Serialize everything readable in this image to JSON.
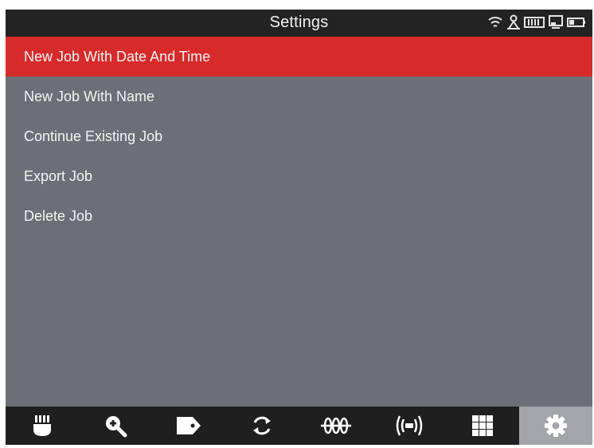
{
  "header": {
    "title": "Settings",
    "status_icons": [
      "wifi-icon",
      "bluetooth-icon",
      "keyboard-icon",
      "monitor-icon",
      "battery-icon"
    ]
  },
  "menu": {
    "items": [
      {
        "label": "New Job With Date And Time",
        "selected": true
      },
      {
        "label": "New Job With Name",
        "selected": false
      },
      {
        "label": "Continue Existing Job",
        "selected": false
      },
      {
        "label": "Export Job",
        "selected": false
      },
      {
        "label": "Delete Job",
        "selected": false
      }
    ]
  },
  "bottom_nav": [
    {
      "icon": "cable-connector-icon",
      "active": false
    },
    {
      "icon": "zoom-in-icon",
      "active": false
    },
    {
      "icon": "tag-icon",
      "active": false
    },
    {
      "icon": "refresh-icon",
      "active": false
    },
    {
      "icon": "coil-icon",
      "active": false
    },
    {
      "icon": "wireless-signal-icon",
      "active": false
    },
    {
      "icon": "grid-icon",
      "active": false
    },
    {
      "icon": "settings-gear-icon",
      "active": true
    }
  ],
  "colors": {
    "accent": "#d72a2a",
    "background": "#6c6f76",
    "titlebar": "#232323",
    "navbar": "#1f1f1f",
    "nav_active": "#a3a5a8"
  }
}
